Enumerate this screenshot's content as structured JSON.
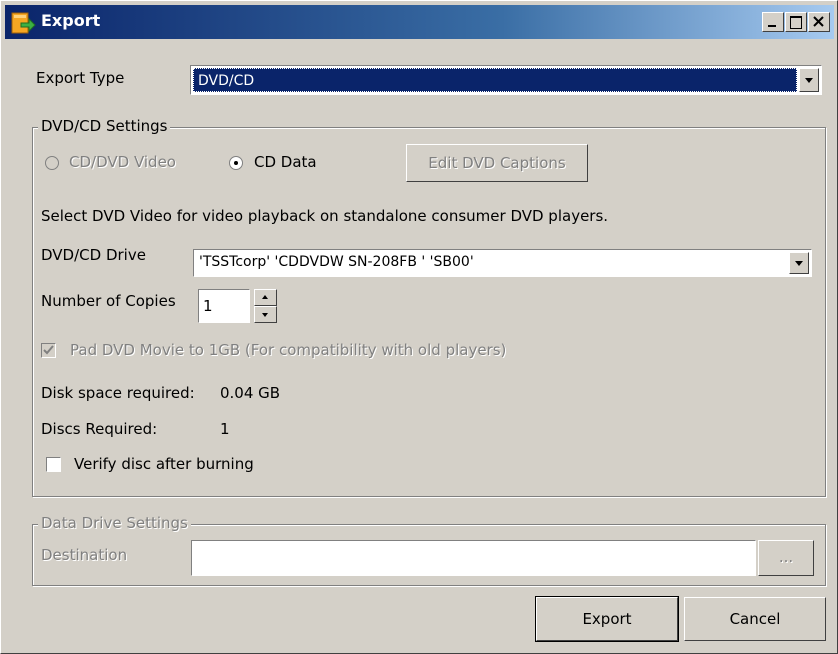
{
  "window": {
    "title": "Export",
    "controls": {
      "minimize": "_",
      "maximize": "□",
      "close": "×"
    }
  },
  "export_type": {
    "label": "Export Type",
    "value": "DVD/CD"
  },
  "dvd_settings": {
    "group_title": "DVD/CD Settings",
    "radio_video": {
      "label": "CD/DVD Video",
      "selected": false,
      "enabled": false
    },
    "radio_data": {
      "label": "CD Data",
      "selected": true,
      "enabled": true
    },
    "edit_captions_button": "Edit DVD Captions",
    "hint": "Select DVD Video for video playback on standalone consumer DVD players.",
    "drive": {
      "label": "DVD/CD Drive",
      "value": "'TSSTcorp' 'CDDVDW SN-208FB ' 'SB00'"
    },
    "copies": {
      "label": "Number of Copies",
      "value": "1"
    },
    "pad_dvd": {
      "label": "Pad DVD Movie to 1GB (For compatibility with old players)",
      "checked": true,
      "enabled": false
    },
    "disk_space": {
      "label": "Disk space required:",
      "value": "0.04 GB"
    },
    "discs_required": {
      "label": "Discs Required:",
      "value": "1"
    },
    "verify": {
      "label": "Verify disc after burning",
      "checked": false
    }
  },
  "data_drive": {
    "group_title": "Data Drive Settings",
    "destination_label": "Destination",
    "destination_value": "",
    "browse_button": "..."
  },
  "footer": {
    "export_button": "Export",
    "cancel_button": "Cancel"
  },
  "colors": {
    "titlebar_start": "#0a246a",
    "titlebar_end": "#a6caf0",
    "selection": "#0a246a",
    "face": "#d4d0c8"
  }
}
